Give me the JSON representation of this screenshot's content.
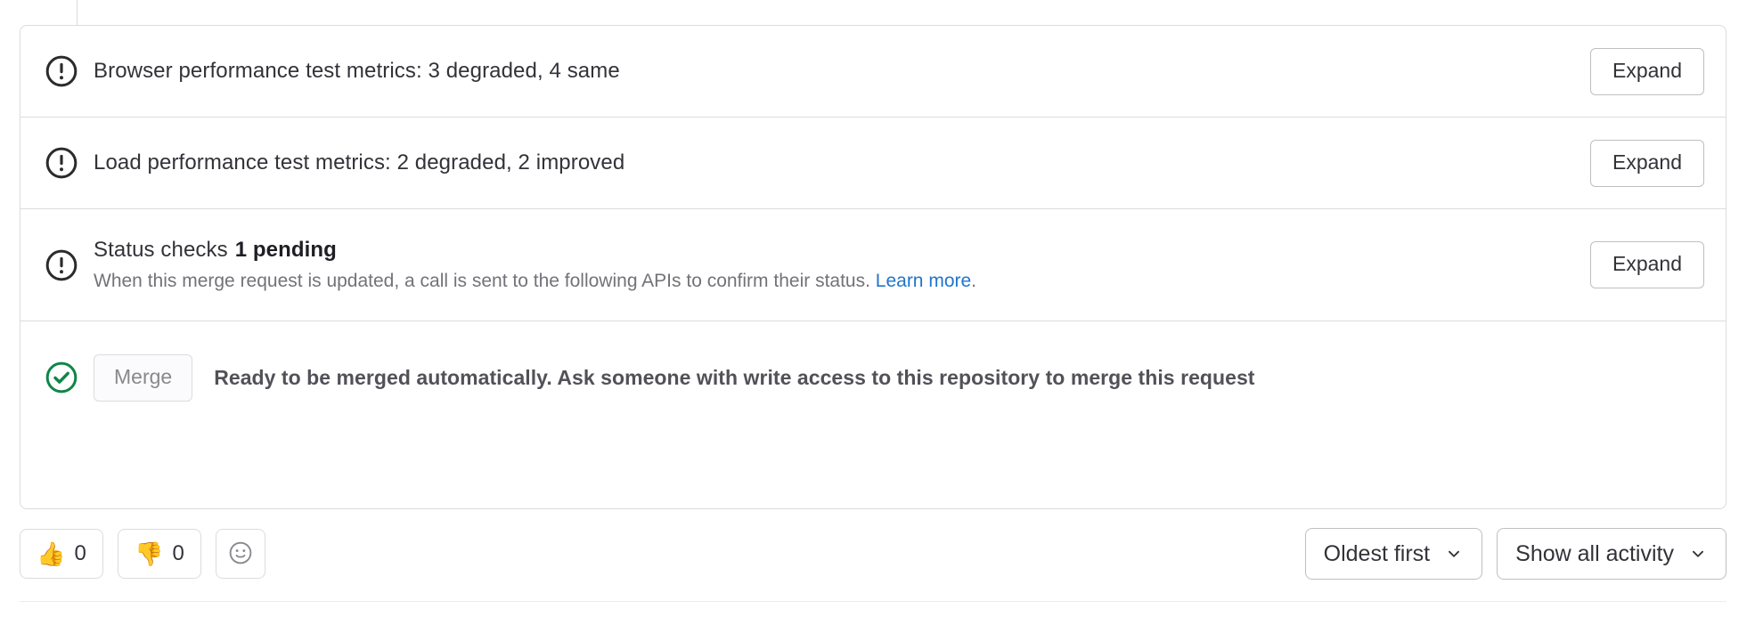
{
  "widget": {
    "rows": [
      {
        "icon": "warning-exclamation-circle-icon",
        "title": "Browser performance test metrics: 3 degraded, 4 same",
        "action_label": "Expand"
      },
      {
        "icon": "warning-exclamation-circle-icon",
        "title": "Load performance test metrics: 2 degraded, 2 improved",
        "action_label": "Expand"
      },
      {
        "icon": "warning-exclamation-circle-icon",
        "title": "Status checks",
        "title_emphasis": "1 pending",
        "description": "When this merge request is updated, a call is sent to the following APIs to confirm their status.",
        "link_label": "Learn more",
        "description_suffix": ".",
        "action_label": "Expand"
      }
    ],
    "merge_row": {
      "icon": "success-check-circle-icon",
      "merge_button_label": "Merge",
      "merge_button_disabled": true,
      "message": "Ready to be merged automatically. Ask someone with write access to this repository to merge this request"
    }
  },
  "footer": {
    "reactions": [
      {
        "icon": "thumbs-up-emoji",
        "emoji": "👍",
        "count": "0"
      },
      {
        "icon": "thumbs-down-emoji",
        "emoji": "👎",
        "count": "0"
      }
    ],
    "add_reaction_icon": "smiley-add-reaction-icon",
    "sort_dropdown": {
      "label": "Oldest first",
      "icon": "chevron-down-icon"
    },
    "filter_dropdown": {
      "label": "Show all activity",
      "icon": "chevron-down-icon"
    }
  },
  "colors": {
    "border": "#dcdcde",
    "strong_border": "#bfbfc3",
    "text": "#333238",
    "muted_text": "#737278",
    "link": "#1f75cb",
    "success_green": "#108548",
    "warning_dark": "#2b2b2b",
    "disabled_text": "#89888d"
  }
}
